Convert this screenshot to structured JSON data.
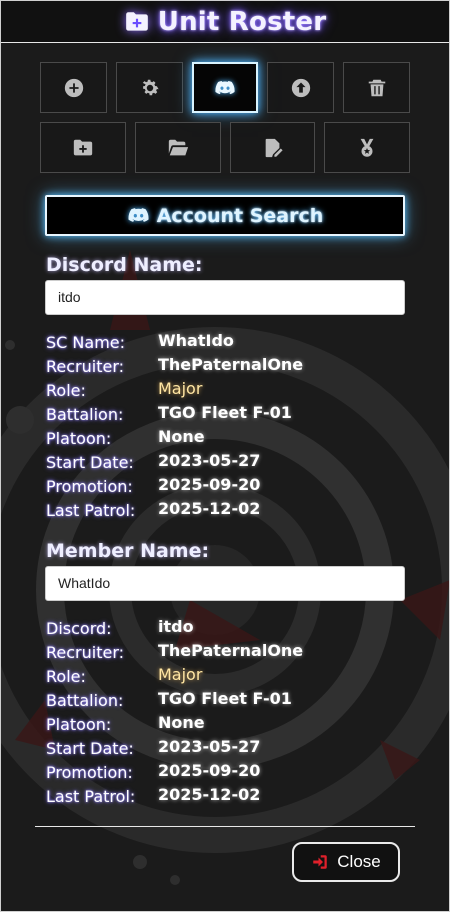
{
  "header": {
    "title": "Unit Roster",
    "icon": "folder-plus-icon"
  },
  "toolbar": {
    "row1": [
      {
        "icon": "plus-circle-icon"
      },
      {
        "icon": "gear-icon"
      },
      {
        "icon": "discord-icon",
        "active": true
      },
      {
        "icon": "upload-circle-icon"
      },
      {
        "icon": "trash-icon"
      }
    ],
    "row2": [
      {
        "icon": "folder-plus-icon"
      },
      {
        "icon": "folder-open-icon"
      },
      {
        "icon": "file-edit-icon"
      },
      {
        "icon": "medal-icon"
      }
    ]
  },
  "search_button": {
    "label": "Account Search",
    "icon": "discord-icon"
  },
  "discord_section": {
    "label": "Discord Name:",
    "value": "itdo",
    "rows": [
      {
        "key": "SC Name:",
        "value": "WhatIdo"
      },
      {
        "key": "Recruiter:",
        "value": "ThePaternalOne"
      },
      {
        "key": "Role:",
        "value": "Major"
      },
      {
        "key": "Battalion:",
        "value": "TGO Fleet F-01"
      },
      {
        "key": "Platoon:",
        "value": "None"
      },
      {
        "key": "Start Date:",
        "value": "2023-05-27"
      },
      {
        "key": "Promotion:",
        "value": "2025-09-20"
      },
      {
        "key": "Last Patrol:",
        "value": "2025-12-02"
      }
    ]
  },
  "member_section": {
    "label": "Member Name:",
    "value": "WhatIdo",
    "rows": [
      {
        "key": "Discord:",
        "value": "itdo"
      },
      {
        "key": "Recruiter:",
        "value": "ThePaternalOne"
      },
      {
        "key": "Role:",
        "value": "Major"
      },
      {
        "key": "Battalion:",
        "value": "TGO Fleet F-01"
      },
      {
        "key": "Platoon:",
        "value": "None"
      },
      {
        "key": "Start Date:",
        "value": "2023-05-27"
      },
      {
        "key": "Promotion:",
        "value": "2025-09-20"
      },
      {
        "key": "Last Patrol:",
        "value": "2025-12-02"
      }
    ]
  },
  "close_button": {
    "label": "Close",
    "icon": "sign-in-icon"
  },
  "colors": {
    "accent_purple": "#8c6cff",
    "accent_blue": "#4fb6ff",
    "close_icon": "#e0202a"
  }
}
